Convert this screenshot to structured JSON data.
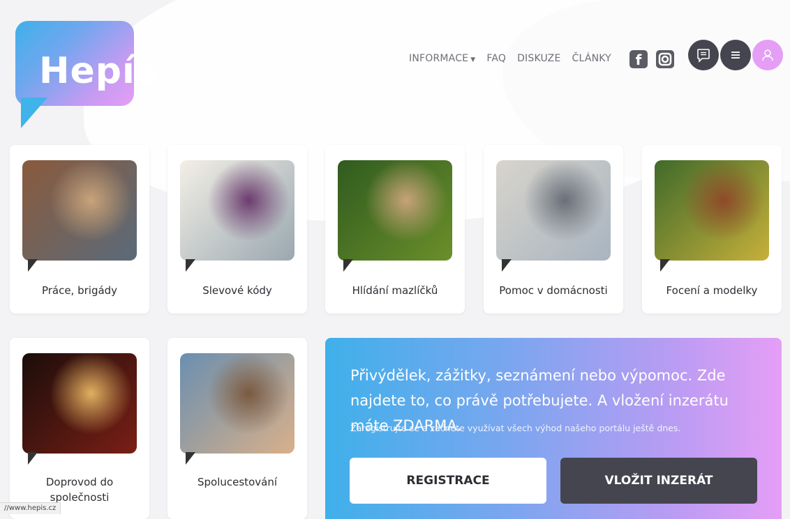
{
  "brand": {
    "logo_text": "Hepís",
    "accent_gradient": [
      "#3fb0ea",
      "#e59ef6"
    ],
    "dark": "#45454f"
  },
  "nav": {
    "items": [
      {
        "label": "INFORMACE",
        "has_dropdown": true
      },
      {
        "label": "FAQ"
      },
      {
        "label": "DISKUZE"
      },
      {
        "label": "ČLÁNKY"
      }
    ],
    "social": [
      "facebook-icon",
      "instagram-icon"
    ],
    "actions": [
      "messages-icon",
      "menu-icon",
      "user-icon"
    ]
  },
  "categories": [
    {
      "label": "Práce, brigády",
      "photo_colors": [
        "#8a5a3c",
        "#5a6b7a",
        "#c9a37a"
      ]
    },
    {
      "label": "Slevové kódy",
      "photo_colors": [
        "#f3efe6",
        "#9aa8b0",
        "#6c3b6f"
      ]
    },
    {
      "label": "Hlídání mazlíčků",
      "photo_colors": [
        "#2f5b1f",
        "#6b8f2a",
        "#c8a27a"
      ]
    },
    {
      "label": "Pomoc v domácnosti",
      "photo_colors": [
        "#d8d4cc",
        "#a8b4c0",
        "#6a6f78"
      ]
    },
    {
      "label": "Focení a modelky",
      "photo_colors": [
        "#3f6a2a",
        "#c7b03a",
        "#8f4a2a"
      ]
    },
    {
      "label": "Doprovod do společnosti",
      "photo_colors": [
        "#1b0d0a",
        "#7a1f16",
        "#e0b060"
      ]
    },
    {
      "label": "Spolucestování",
      "photo_colors": [
        "#6a8fb0",
        "#d9b08a",
        "#7a5a40"
      ]
    }
  ],
  "promo": {
    "title": "Přivýdělek, zážitky, seznámení nebo výpomoc. Zde najdete to, co právě potřebujete. A vložení inzerátu máte ZDARMA.",
    "subtitle": "Zaregistrujte se a začněte využívat všech výhod našeho portálu ještě dnes.",
    "register_label": "REGISTRACE",
    "insert_label": "VLOŽIT INZERÁT"
  },
  "status_bar": {
    "url": "//www.hepis.cz"
  }
}
